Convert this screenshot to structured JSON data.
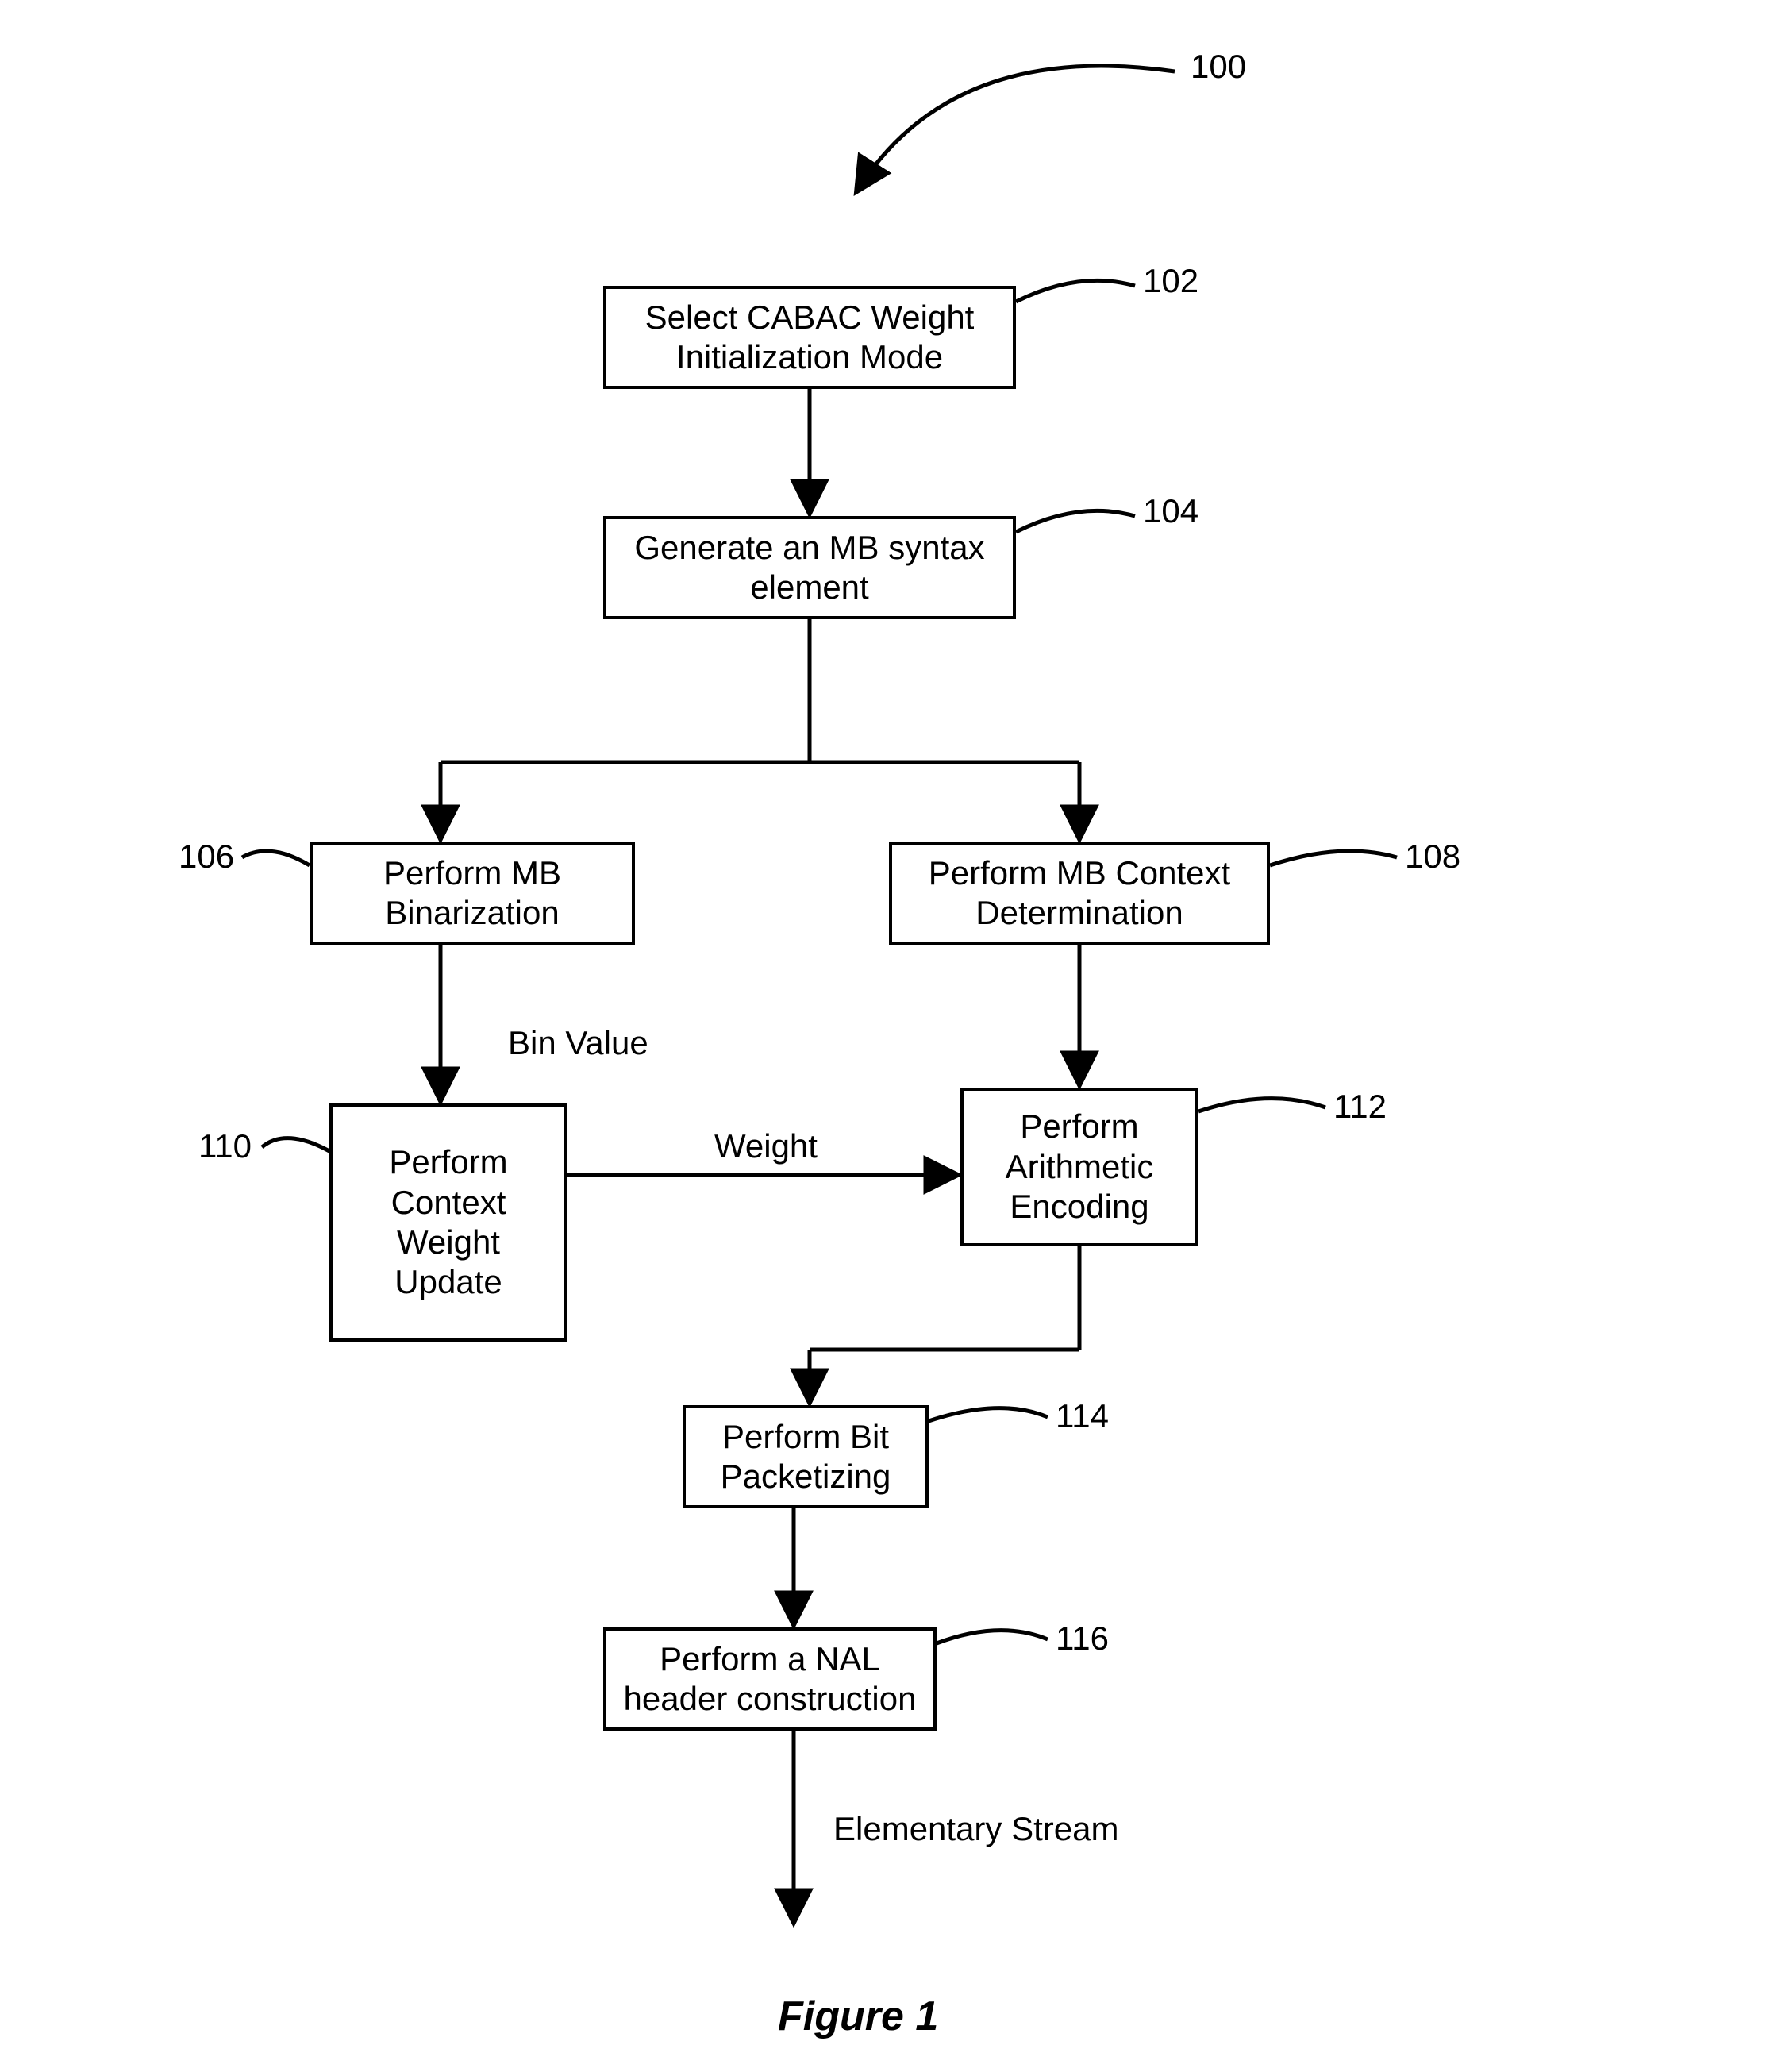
{
  "refs": {
    "r100": "100",
    "r102": "102",
    "r104": "104",
    "r106": "106",
    "r108": "108",
    "r110": "110",
    "r112": "112",
    "r114": "114",
    "r116": "116"
  },
  "boxes": {
    "b102": "Select CABAC Weight Initialization Mode",
    "b104": "Generate an MB syntax element",
    "b106": "Perform MB Binarization",
    "b108": "Perform MB Context Determination",
    "b110": "Perform Context Weight Update",
    "b112": "Perform Arithmetic Encoding",
    "b114": "Perform Bit Packetizing",
    "b116": "Perform a NAL header construction"
  },
  "edges": {
    "binvalue": "Bin Value",
    "weight": "Weight",
    "elementary": "Elementary Stream"
  },
  "figure": "Figure 1"
}
